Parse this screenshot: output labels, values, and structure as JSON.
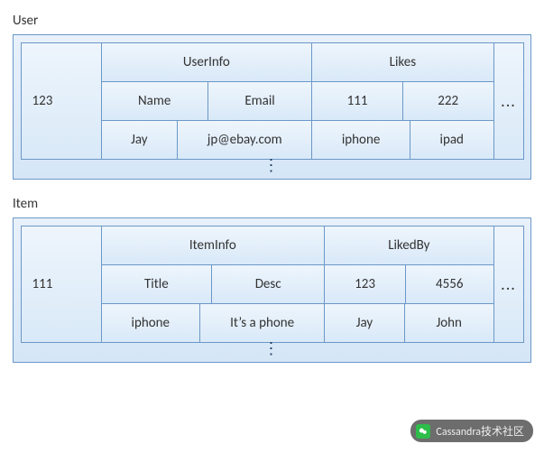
{
  "tables": {
    "user": {
      "label": "User",
      "row_key": "123",
      "supercolumns": [
        {
          "name": "UserInfo",
          "columns": [
            {
              "name": "Name",
              "value": "Jay"
            },
            {
              "name": "Email",
              "value": "jp@ebay.com"
            }
          ]
        },
        {
          "name": "Likes",
          "columns": [
            {
              "name": "111",
              "value": "iphone"
            },
            {
              "name": "222",
              "value": "ipad"
            }
          ]
        }
      ],
      "ellipsis_right": "...",
      "ellipsis_bottom": "⋮"
    },
    "item": {
      "label": "Item",
      "row_key": "111",
      "supercolumns": [
        {
          "name": "ItemInfo",
          "columns": [
            {
              "name": "Title",
              "value": "iphone"
            },
            {
              "name": "Desc",
              "value": "It’s a phone"
            }
          ]
        },
        {
          "name": "LikedBy",
          "columns": [
            {
              "name": "123",
              "value": "Jay"
            },
            {
              "name": "4556",
              "value": "John"
            }
          ]
        }
      ],
      "ellipsis_right": "...",
      "ellipsis_bottom": "⋮"
    }
  },
  "watermark": {
    "text": "Cassandra技术社区"
  }
}
